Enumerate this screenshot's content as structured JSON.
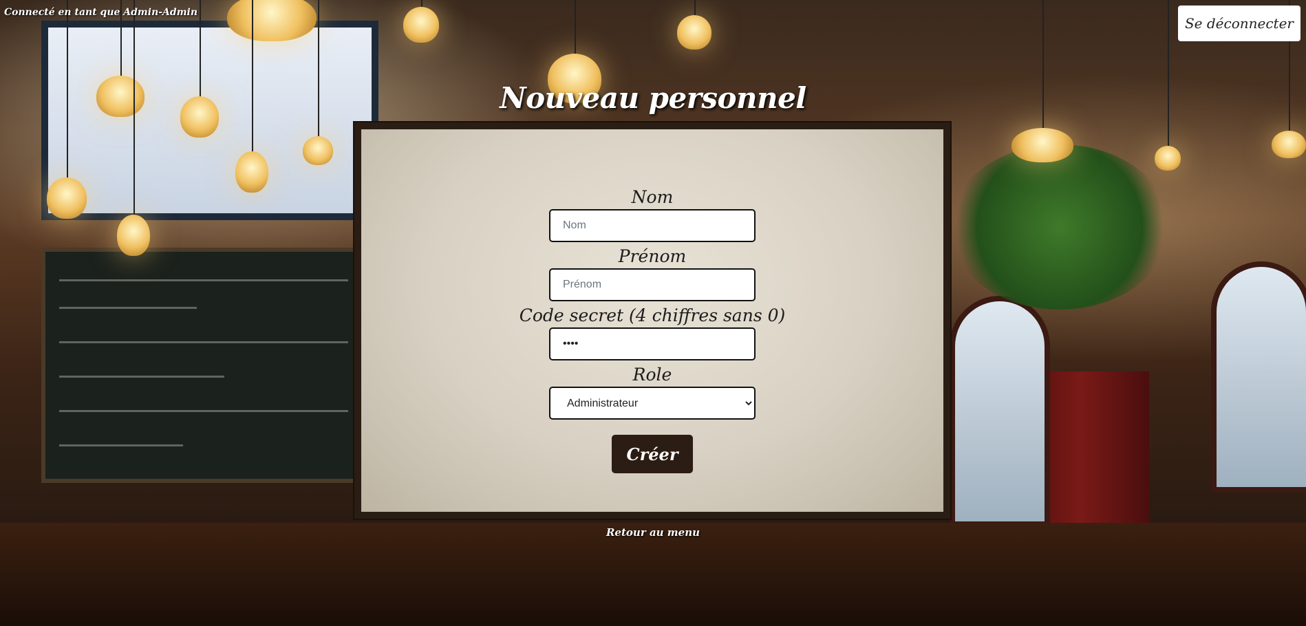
{
  "header": {
    "logged_in_as": "Connecté en tant que Admin-Admin",
    "logout_label": "Se déconnecter"
  },
  "page": {
    "title": "Nouveau personnel"
  },
  "form": {
    "nom": {
      "label": "Nom",
      "placeholder": "Nom",
      "value": ""
    },
    "prenom": {
      "label": "Prénom",
      "placeholder": "Prénom",
      "value": ""
    },
    "code": {
      "label": "Code secret (4 chiffres sans 0)",
      "value": "••••"
    },
    "role": {
      "label": "Role",
      "selected": "Administrateur"
    },
    "submit_label": "Créer"
  },
  "footer": {
    "back_label": "Retour au menu"
  },
  "colors": {
    "panel_border": "#2a1d14",
    "button_bg": "#2b1c14",
    "text_light": "#ffffff"
  }
}
